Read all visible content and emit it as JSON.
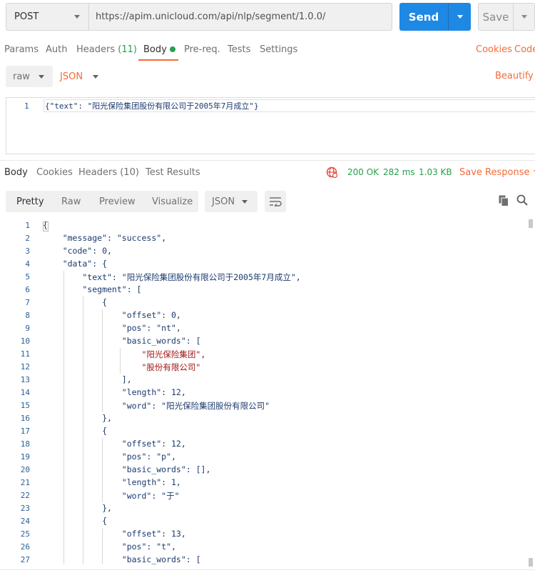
{
  "request": {
    "method": "POST",
    "url": "https://apim.unicloud.com/api/nlp/segment/1.0.0/",
    "send_label": "Send",
    "save_label": "Save"
  },
  "request_tabs": {
    "params": "Params",
    "auth": "Auth",
    "headers": "Headers",
    "headers_count": "(11)",
    "body": "Body",
    "prereq": "Pre-req.",
    "tests": "Tests",
    "settings": "Settings",
    "cookies": "Cookies",
    "code": "Code"
  },
  "body_options": {
    "mode": "raw",
    "language": "JSON",
    "beautify": "Beautify"
  },
  "request_editor": {
    "line_number": "1",
    "code": "{\"text\": \"阳光保险集团股份有限公司于2005年7月成立\"}"
  },
  "response_tabs": {
    "body": "Body",
    "cookies": "Cookies",
    "headers": "Headers (10)",
    "test_results": "Test Results"
  },
  "response_status": {
    "status": "200 OK",
    "time": "282 ms",
    "size": "1.03 KB",
    "save_response": "Save Response"
  },
  "response_view": {
    "pretty": "Pretty",
    "raw": "Raw",
    "preview": "Preview",
    "visualize": "Visualize",
    "format": "JSON"
  },
  "response_lines": [
    {
      "n": "1",
      "t": "{"
    },
    {
      "n": "2",
      "t": "    \"message\": \"success\","
    },
    {
      "n": "3",
      "t": "    \"code\": 0,"
    },
    {
      "n": "4",
      "t": "    \"data\": {"
    },
    {
      "n": "5",
      "t": "        \"text\": \"阳光保险集团股份有限公司于2005年7月成立\","
    },
    {
      "n": "6",
      "t": "        \"segment\": ["
    },
    {
      "n": "7",
      "t": "            {"
    },
    {
      "n": "8",
      "t": "                \"offset\": 0,"
    },
    {
      "n": "9",
      "t": "                \"pos\": \"nt\","
    },
    {
      "n": "10",
      "t": "                \"basic_words\": ["
    },
    {
      "n": "11",
      "t": "                    \"阳光保险集团\","
    },
    {
      "n": "12",
      "t": "                    \"股份有限公司\""
    },
    {
      "n": "13",
      "t": "                ],"
    },
    {
      "n": "14",
      "t": "                \"length\": 12,"
    },
    {
      "n": "15",
      "t": "                \"word\": \"阳光保险集团股份有限公司\""
    },
    {
      "n": "16",
      "t": "            },"
    },
    {
      "n": "17",
      "t": "            {"
    },
    {
      "n": "18",
      "t": "                \"offset\": 12,"
    },
    {
      "n": "19",
      "t": "                \"pos\": \"p\","
    },
    {
      "n": "20",
      "t": "                \"basic_words\": [],"
    },
    {
      "n": "21",
      "t": "                \"length\": 1,"
    },
    {
      "n": "22",
      "t": "                \"word\": \"于\""
    },
    {
      "n": "23",
      "t": "            },"
    },
    {
      "n": "24",
      "t": "            {"
    },
    {
      "n": "25",
      "t": "                \"offset\": 13,"
    },
    {
      "n": "26",
      "t": "                \"pos\": \"t\","
    },
    {
      "n": "27",
      "t": "                \"basic_words\": ["
    }
  ],
  "colors": {
    "accent_blue": "#1e88e5",
    "accent_orange": "#f26b3a",
    "status_green": "#26a14a",
    "line_number": "#2a6099",
    "json_key": "#1c3a6e",
    "json_string_array": "#a31515"
  }
}
